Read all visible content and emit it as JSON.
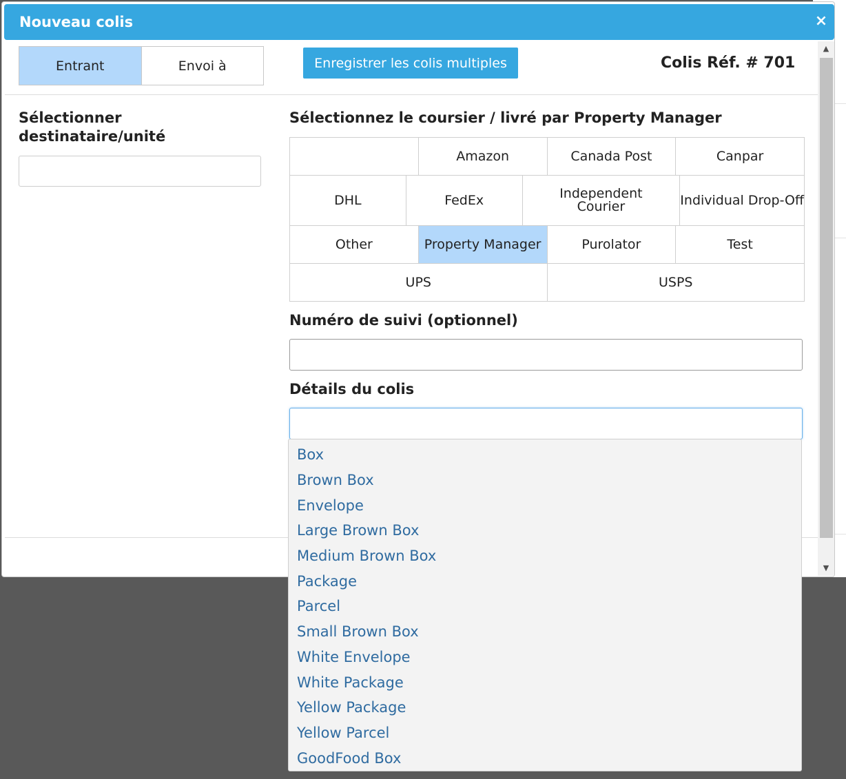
{
  "modal": {
    "title": "Nouveau colis",
    "close_label": "×"
  },
  "tabs": [
    {
      "label": "Entrant",
      "active": true
    },
    {
      "label": "Envoi à",
      "active": false
    }
  ],
  "multi_button_label": "Enregistrer les colis multiples",
  "reference": "Colis Réf. # 701",
  "recipient": {
    "label": "Sélectionner destinataire/unité",
    "value": ""
  },
  "courier": {
    "label": "Sélectionnez le coursier / livré par Property Manager",
    "rows": [
      [
        "",
        "Amazon",
        "Canada Post",
        "Canpar"
      ],
      [
        "DHL",
        "FedEx",
        "Independent Courier",
        "Individual Drop-Off"
      ],
      [
        "Other",
        "Property Manager",
        "Purolator",
        "Test"
      ],
      [
        "UPS",
        "USPS"
      ]
    ],
    "selected": "Property Manager"
  },
  "tracking": {
    "label": "Numéro de suivi (optionnel)",
    "value": ""
  },
  "details": {
    "label": "Détails du colis",
    "value": "",
    "options": [
      "Box",
      "Brown Box",
      "Envelope",
      "Large Brown Box",
      "Medium Brown Box",
      "Package",
      "Parcel",
      "Small Brown Box",
      "White Envelope",
      "White Package",
      "Yellow Package",
      "Yellow Parcel",
      "GoodFood Box"
    ]
  },
  "colors": {
    "header": "#36a7e0",
    "selected": "#b3d8fb",
    "link": "#2f6ba0"
  },
  "icons": {
    "close": "close-icon",
    "scroll_up": "scroll-up-arrow-icon",
    "scroll_down": "scroll-down-arrow-icon"
  }
}
